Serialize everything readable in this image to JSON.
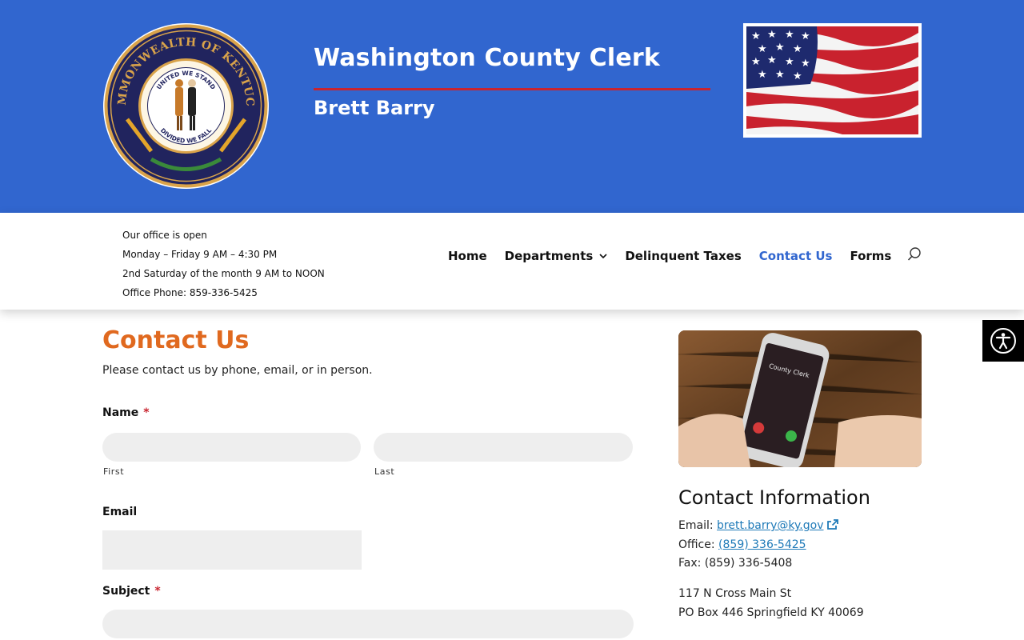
{
  "header": {
    "seal_text_top": "COMMONWEALTH OF KENTUCKY",
    "seal_text_inner_top": "UNITED WE STAND",
    "seal_text_inner_bottom": "DIVIDED WE FALL",
    "title": "Washington County Clerk",
    "subtitle": "Brett Barry"
  },
  "hours": {
    "line1": "Our office is open",
    "line2": "Monday – Friday 9 AM – 4:30 PM",
    "line3": "2nd Saturday of the month 9 AM to NOON",
    "line4": "Office Phone: 859-336-5425"
  },
  "nav": {
    "items": [
      {
        "label": "Home"
      },
      {
        "label": "Departments"
      },
      {
        "label": "Delinquent Taxes"
      },
      {
        "label": "Contact Us"
      },
      {
        "label": "Forms"
      }
    ],
    "active": "Contact Us",
    "search_icon": "search-icon"
  },
  "main": {
    "title": "Contact Us",
    "intro": "Please contact us by phone, email, or in person.",
    "form": {
      "name_label": "Name",
      "required_mark": "*",
      "first_sublabel": "First",
      "last_sublabel": "Last",
      "email_label": "Email",
      "subject_label": "Subject"
    }
  },
  "sidebar": {
    "photo_screen_text": "County Clerk",
    "contact_title": "Contact Information",
    "email_prefix": "Email:",
    "email": "brett.barry@ky.gov",
    "office_prefix": "Office:",
    "office_phone": "(859) 336-5425",
    "fax": "Fax: (859) 336-5408",
    "address_line1": "117 N Cross Main St",
    "address_line2": "PO Box 446 Springfield KY 40069"
  },
  "colors": {
    "banner": "#3166cf",
    "accent_red": "#c8242f",
    "title_orange": "#e0691f",
    "link": "#1f7ab8"
  }
}
